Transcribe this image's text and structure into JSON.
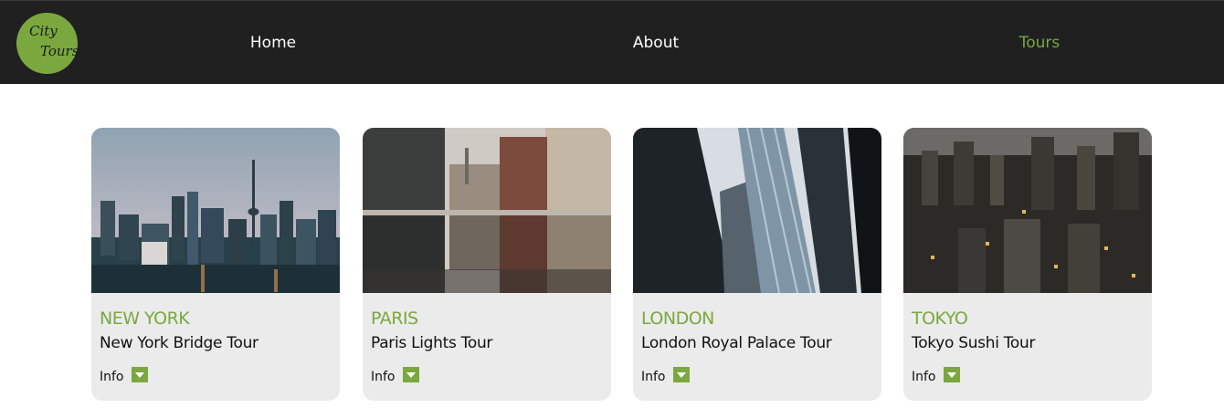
{
  "brand": {
    "logo_line1": "City",
    "logo_line2": "Tours"
  },
  "nav": {
    "items": [
      {
        "label": "Home"
      },
      {
        "label": "About"
      },
      {
        "label": "Tours"
      }
    ],
    "active": "Tours"
  },
  "colors": {
    "accent": "#7aa83e",
    "navbar": "#202020",
    "card": "#ebebeb"
  },
  "tours": [
    {
      "city": "NEW YORK",
      "title": "New York Bridge Tour",
      "info_label": "Info",
      "image": "city-skyline-with-tower-photo",
      "toggle_icon": "chevron-down-icon"
    },
    {
      "city": "PARIS",
      "title": "Paris Lights Tour",
      "info_label": "Info",
      "image": "street-reflection-photo",
      "toggle_icon": "chevron-down-icon"
    },
    {
      "city": "LONDON",
      "title": "London Royal Palace Tour",
      "info_label": "Info",
      "image": "skyscraper-upward-view-photo",
      "toggle_icon": "chevron-down-icon"
    },
    {
      "city": "TOKYO",
      "title": "Tokyo Sushi Tour",
      "info_label": "Info",
      "image": "night-city-aerial-photo",
      "toggle_icon": "chevron-down-icon"
    }
  ]
}
